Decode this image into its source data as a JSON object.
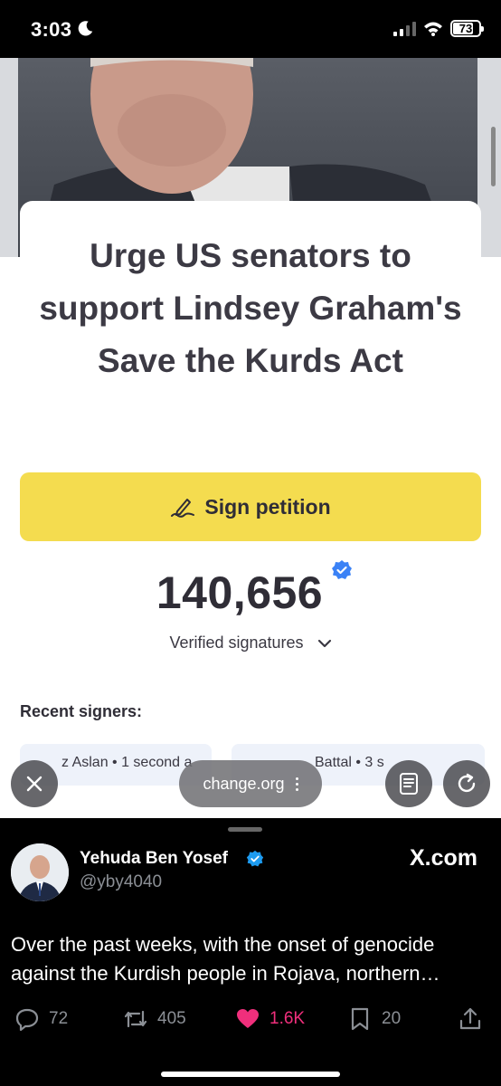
{
  "status_bar": {
    "time": "3:03",
    "battery": "73"
  },
  "petition": {
    "title": "Urge US senators to support Lindsey Graham's Save the Kurds Act",
    "sign_label": "Sign petition",
    "signature_count": "140,656",
    "verified_label": "Verified signatures",
    "recent_label": "Recent signers:",
    "signers": [
      {
        "text": "z Aslan • 1 second a"
      },
      {
        "text": "Battal • 3 s"
      }
    ]
  },
  "browser": {
    "url": "change.org"
  },
  "tweet": {
    "author": "Yehuda Ben Yosef",
    "handle": "@yby4040",
    "source": "X.com",
    "text": "Over the past weeks, with the onset of genocide against the Kurdish people in Rojava, northern…",
    "replies": "72",
    "retweets": "405",
    "likes": "1.6K",
    "bookmarks": "20",
    "like_color": "#f02f7c"
  },
  "colors": {
    "sign_button": "#f4dc4f",
    "verified_blue": "#3b82f6"
  }
}
